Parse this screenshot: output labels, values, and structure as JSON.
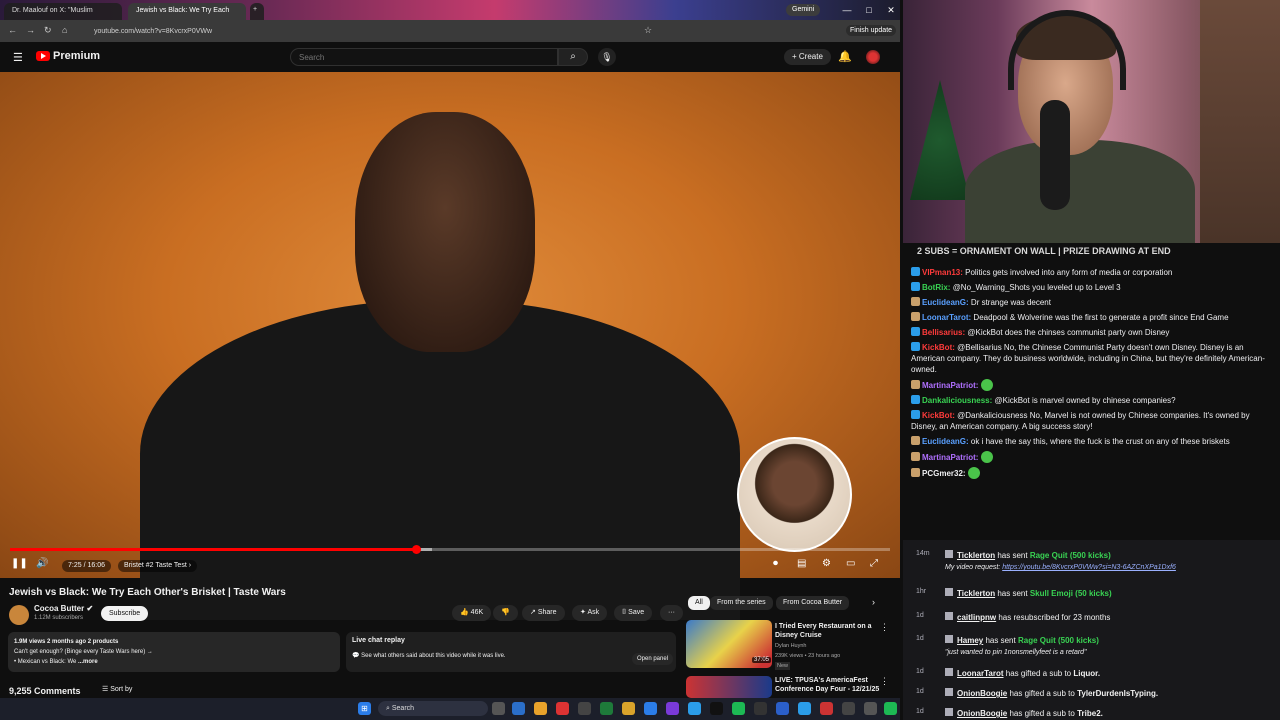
{
  "browser": {
    "tabs": [
      {
        "label": "Dr. Maalouf on X: \"Muslim"
      },
      {
        "label": "Jewish vs Black: We Try Each"
      }
    ],
    "gemini_label": "Gemini",
    "url": "youtube.com/watch?v=8KvcrxP0VWw",
    "finish_update_label": "Finish update",
    "window_controls": [
      "—",
      "□",
      "✕"
    ]
  },
  "youtube": {
    "logo_label": "Premium",
    "search_placeholder": "Search",
    "create_label": "Create",
    "player": {
      "current_time": "7:25 / 16:06",
      "chapter": "Bristet #2 Taste Test",
      "progress_fraction": 0.461,
      "buffer_fraction": 0.48
    },
    "video": {
      "title": "Jewish vs Black: We Try Each Other's Brisket | Taste Wars",
      "channel": "Cocoa Butter",
      "subscribers": "1.12M subscribers",
      "subscribe_label": "Subscribe",
      "likes": "46K",
      "share_label": "Share",
      "ask_label": "Ask",
      "save_label": "Save",
      "more_label": "···"
    },
    "description": {
      "stats": "1.9M views  2 months ago  2 products",
      "line1": "Can't get enough? (Binge every Taste Wars here) →",
      "line2": "• Mexican vs Black: We",
      "more": "...more"
    },
    "live_chat": {
      "title": "Live chat replay",
      "text": "See what others said about this video while it was live.",
      "button": "Open panel"
    },
    "comments": {
      "count": "9,255 Comments",
      "sort_label": "Sort by"
    },
    "chips": [
      "All",
      "From the series",
      "From Cocoa Butter"
    ],
    "recommendations": [
      {
        "title": "I Tried Every Restaurant on a Disney Cruise",
        "channel": "Dylan Huynh",
        "meta": "239K views • 23 hours ago",
        "badge": "New",
        "duration": "37:05"
      },
      {
        "title": "LIVE: TPUSA's AmericaFest Conference Day Four - 12/21/25",
        "channel": "",
        "meta": "",
        "badge": "",
        "duration": ""
      }
    ]
  },
  "taskbar": {
    "search_label": "Search"
  },
  "stream": {
    "banner": "2 SUBS = ORNAMENT ON WALL | PRIZE DRAWING AT END",
    "chat": [
      {
        "user": "VIPman13:",
        "color": "#ff3b3b",
        "text": "Politics gets involved into any form of media or corporation"
      },
      {
        "user": "BotRix:",
        "color": "#39d353",
        "text": "@No_Warning_Shots you leveled up to Level 3"
      },
      {
        "user": "EuclideanG:",
        "color": "#5aa0ff",
        "text": "Dr strange was decent"
      },
      {
        "user": "LoonarTarot:",
        "color": "#5aa0ff",
        "text": "Deadpool & Wolverine was the first to generate a profit since End Game"
      },
      {
        "user": "Bellisarius:",
        "color": "#ff3b3b",
        "text": "@KickBot does the chinses communist party own Disney"
      },
      {
        "user": "KickBot:",
        "color": "#ff3b3b",
        "text": "@Bellisarius No, the Chinese Communist Party doesn't own Disney. Disney is an American company. They do business worldwide, including in China, but they're definitely American-owned."
      },
      {
        "user": "MartinaPatriot:",
        "color": "#b070ff",
        "text": ""
      },
      {
        "user": "Dankaliciousness:",
        "color": "#39d353",
        "text": "@KickBot is marvel owned by chinese companies?"
      },
      {
        "user": "KickBot:",
        "color": "#ff3b3b",
        "text": "@Dankaliciousness No, Marvel is not owned by Chinese companies. It's owned by Disney, an American company. A big success story!"
      },
      {
        "user": "EuclideanG:",
        "color": "#5aa0ff",
        "text": "ok i have the say this, where the fuck is the crust on any of these briskets"
      },
      {
        "user": "MartinaPatriot:",
        "color": "#b070ff",
        "text": ""
      },
      {
        "user": "PCGmer32:",
        "color": "#efeff1",
        "text": ""
      }
    ],
    "events": [
      {
        "time": "14m",
        "user": "Ticklerton",
        "action": "has sent",
        "item": "Rage Quit (500 kicks)",
        "sub_label": "My video request:",
        "sub_link": "https://youtu.be/8KvcrxP0VWw?si=N3-6AZCnXPa1Dxf6"
      },
      {
        "time": "1hr",
        "user": "Ticklerton",
        "action": "has sent",
        "item": "Skull Emoji (50 kicks)",
        "sub_label": "",
        "sub_link": ""
      },
      {
        "time": "1d",
        "user": "caitlinpnw",
        "action": "has resubscribed for 23 months",
        "item": "",
        "sub_label": "",
        "sub_link": ""
      },
      {
        "time": "1d",
        "user": "Hamey",
        "action": "has sent",
        "item": "Rage Quit (500 kicks)",
        "sub_label": "\"just wanted to pin 1nonsmellyfeet is a retard\"",
        "sub_link": ""
      },
      {
        "time": "1d",
        "user": "LoonarTarot",
        "action": "has gifted a sub to",
        "item": "Liquor.",
        "sub_label": "",
        "sub_link": ""
      },
      {
        "time": "1d",
        "user": "OnionBoogie",
        "action": "has gifted a sub to",
        "item": "TylerDurdenIsTyping.",
        "sub_label": "",
        "sub_link": ""
      },
      {
        "time": "1d",
        "user": "OnionBoogie",
        "action": "has gifted a sub to",
        "item": "Tribe2.",
        "sub_label": "",
        "sub_link": ""
      }
    ]
  },
  "colors": {
    "youtube_red": "#ff0000",
    "kick_green": "#39d353",
    "background": "#0f0f0f"
  }
}
